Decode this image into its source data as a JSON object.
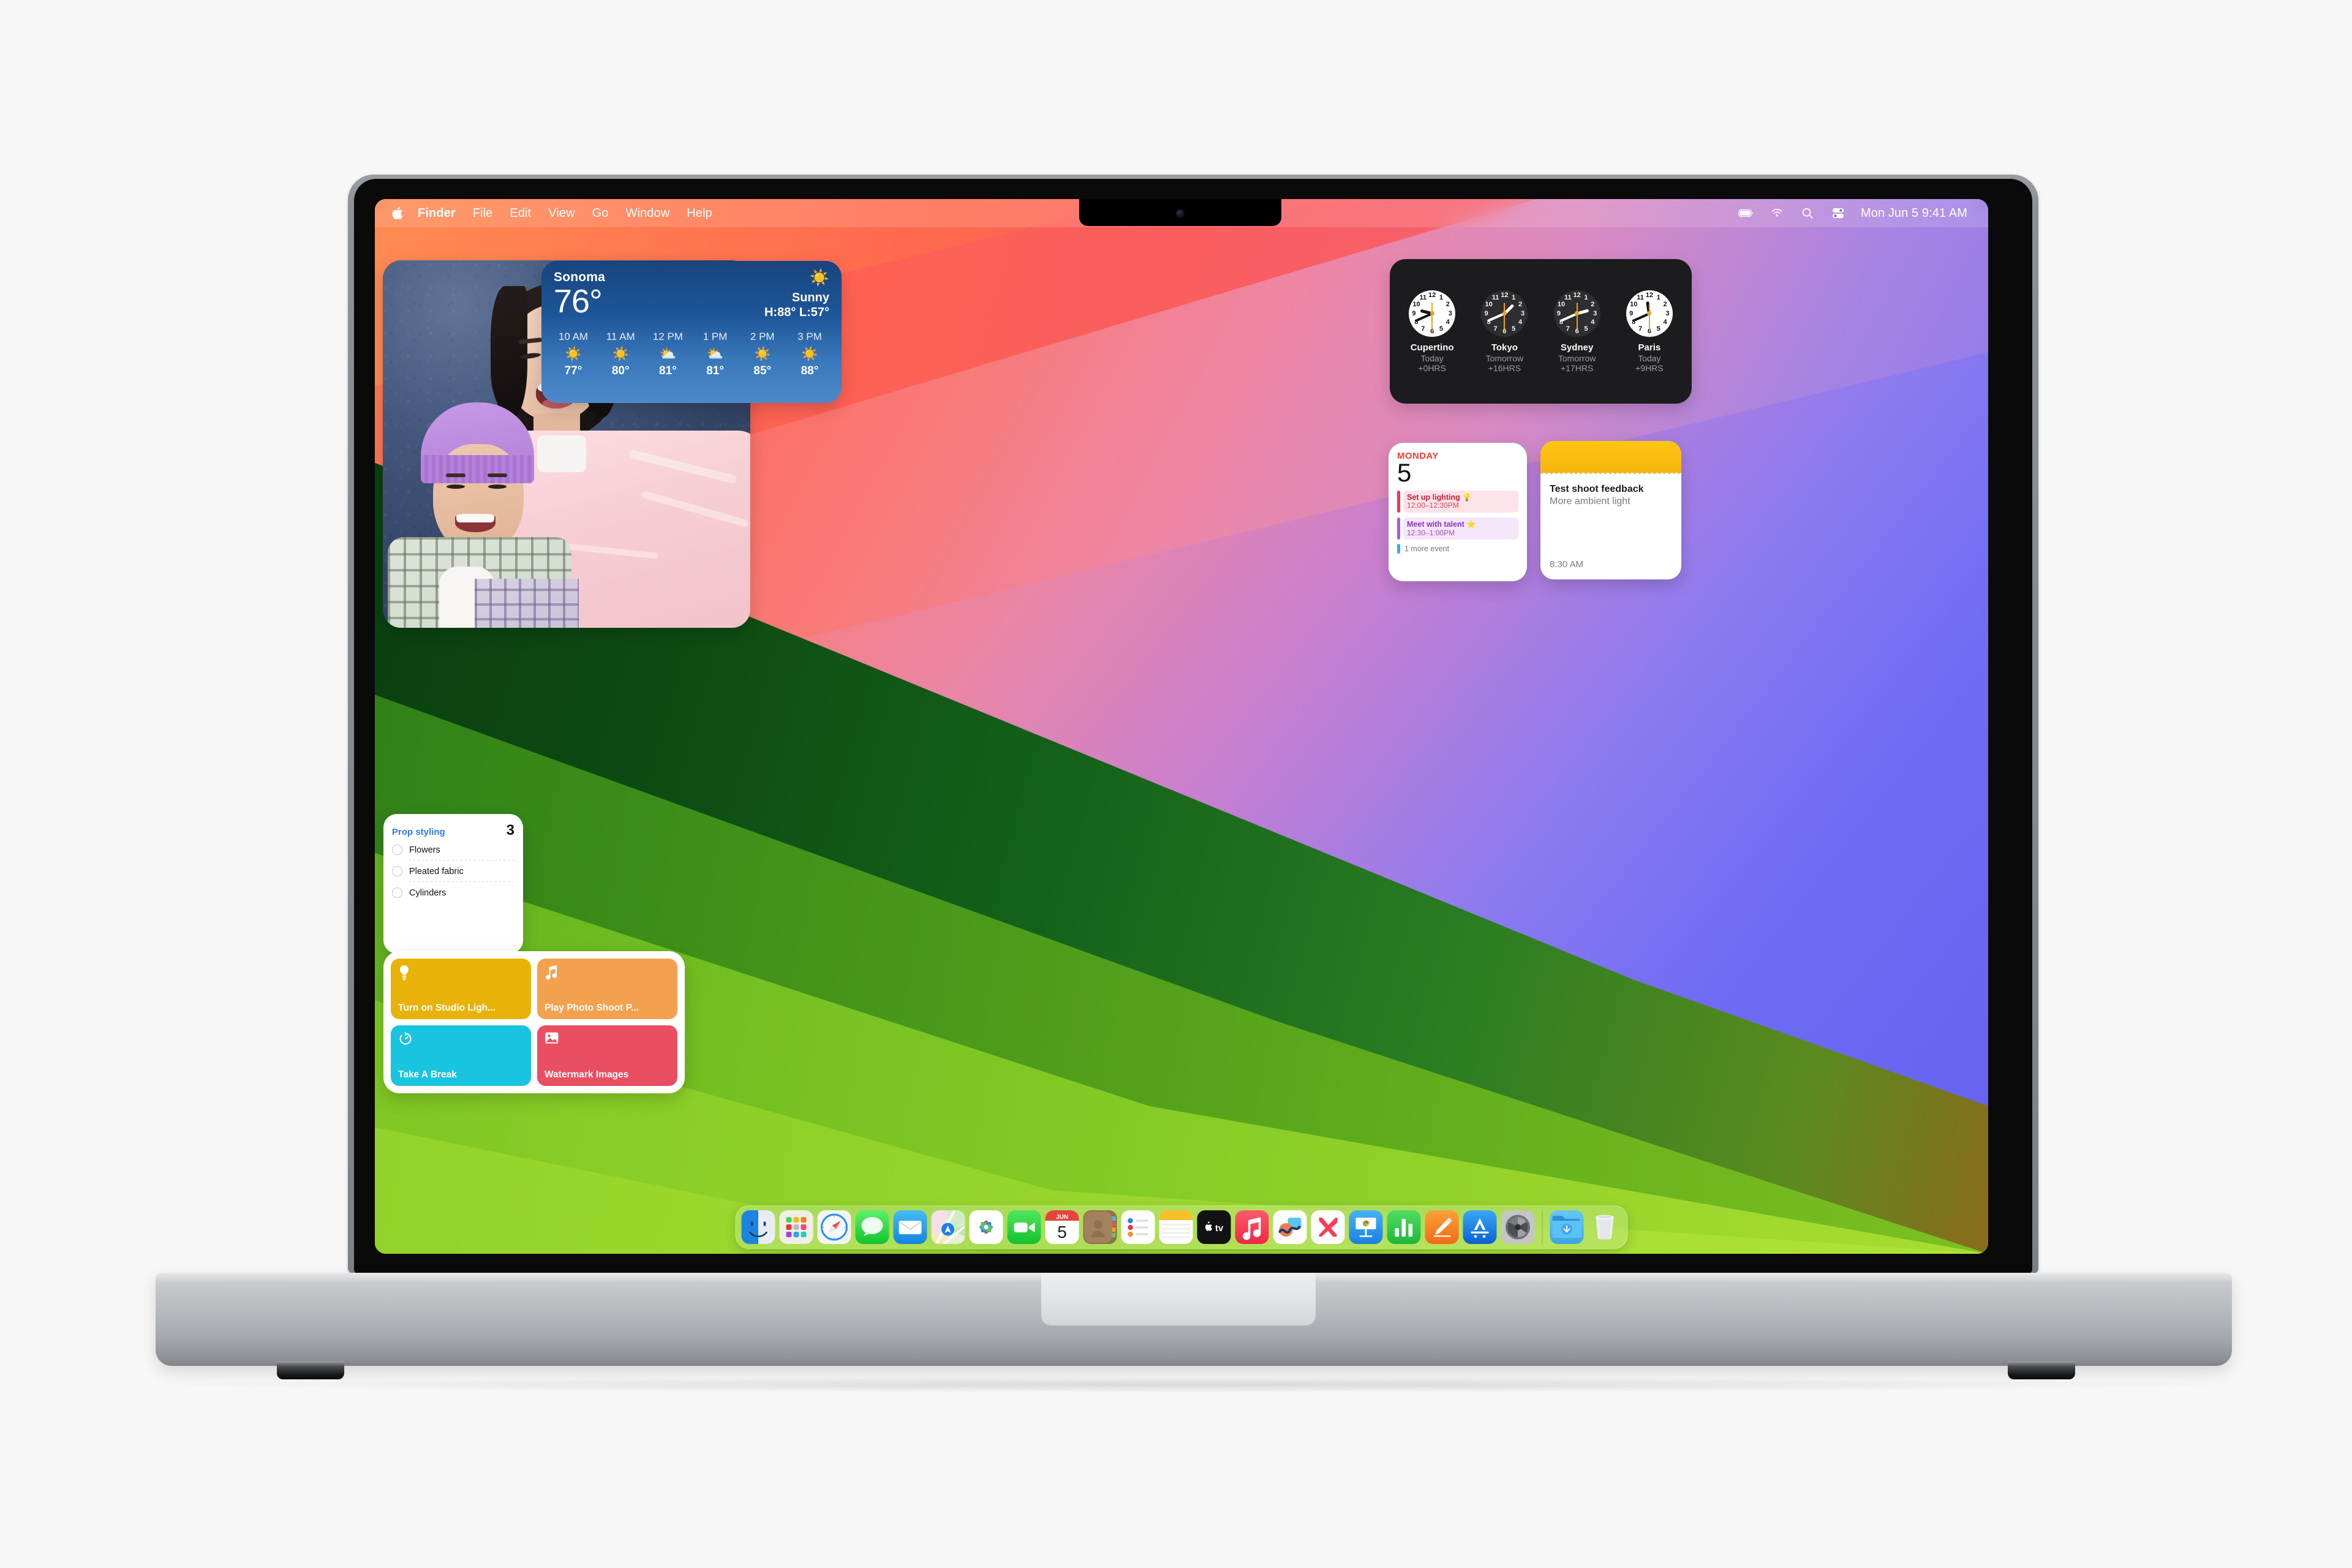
{
  "menubar": {
    "apple_icon": "apple-logo-icon",
    "items": [
      {
        "label": "Finder",
        "bold": true
      },
      {
        "label": "File",
        "bold": false
      },
      {
        "label": "Edit",
        "bold": false
      },
      {
        "label": "View",
        "bold": false
      },
      {
        "label": "Go",
        "bold": false
      },
      {
        "label": "Window",
        "bold": false
      },
      {
        "label": "Help",
        "bold": false
      }
    ],
    "status_icons": [
      "battery-icon",
      "wifi-icon",
      "search-icon",
      "control-center-icon"
    ],
    "clock": "Mon Jun 5  9:41 AM"
  },
  "weather": {
    "city": "Sonoma",
    "temperature": "76°",
    "condition_icon": "sun-icon",
    "condition": "Sunny",
    "high_low": "H:88° L:57°",
    "hours": [
      {
        "time": "10 AM",
        "icon": "sun-icon",
        "glyph": "☀️",
        "temp": "77°"
      },
      {
        "time": "11 AM",
        "icon": "sun-icon",
        "glyph": "☀️",
        "temp": "80°"
      },
      {
        "time": "12 PM",
        "icon": "sun-behind-cloud-icon",
        "glyph": "⛅",
        "temp": "81°"
      },
      {
        "time": "1 PM",
        "icon": "sun-behind-cloud-icon",
        "glyph": "⛅",
        "temp": "81°"
      },
      {
        "time": "2 PM",
        "icon": "sun-icon",
        "glyph": "☀️",
        "temp": "85°"
      },
      {
        "time": "3 PM",
        "icon": "sun-icon",
        "glyph": "☀️",
        "temp": "88°"
      }
    ]
  },
  "world_clock": {
    "clocks": [
      {
        "city": "Cupertino",
        "day": "Today",
        "offset": "+0HRS",
        "theme": "light",
        "hour_deg": 284,
        "minute_deg": 246
      },
      {
        "city": "Tokyo",
        "day": "Tomorrow",
        "offset": "+16HRS",
        "theme": "dark",
        "hour_deg": 45,
        "minute_deg": 246
      },
      {
        "city": "Sydney",
        "day": "Tomorrow",
        "offset": "+17HRS",
        "theme": "dark",
        "hour_deg": 75,
        "minute_deg": 246
      },
      {
        "city": "Paris",
        "day": "Today",
        "offset": "+9HRS",
        "theme": "light",
        "hour_deg": 352,
        "minute_deg": 246
      }
    ],
    "numerals": [
      "12",
      "1",
      "2",
      "3",
      "4",
      "5",
      "6",
      "7",
      "8",
      "9",
      "10",
      "11"
    ]
  },
  "calendar": {
    "weekday": "MONDAY",
    "date": "5",
    "events": [
      {
        "title": "Set up lighting 💡",
        "time": "12:00–12:30PM",
        "accent": "#fb2e52",
        "bg": "#fde3e8",
        "fg": "#c2203d"
      },
      {
        "title": "Meet with talent ⭐",
        "time": "12:30–1:00PM",
        "accent": "#b356e0",
        "bg": "#f5e6fa",
        "fg": "#8a36b5"
      }
    ],
    "more_label": "1 more event",
    "more_accent": "#32ade6"
  },
  "notes": {
    "title": "Test shoot feedback",
    "subtitle": "More ambient light",
    "time": "8:30 AM",
    "header_color": "#fdc612"
  },
  "reminders": {
    "list_title": "Prop styling",
    "count": "3",
    "items": [
      {
        "label": "Flowers"
      },
      {
        "label": "Pleated fabric"
      },
      {
        "label": "Cylinders"
      }
    ]
  },
  "shortcuts": {
    "tiles": [
      {
        "label": "Turn on Studio Ligh...",
        "icon": "lightbulb-icon",
        "glyph": "💡",
        "color": "#e8b209"
      },
      {
        "label": "Play Photo Shoot P...",
        "icon": "music-note-icon",
        "glyph": "♪",
        "color": "#f3a council"
      },
      {
        "label": "Take A Break",
        "icon": "timer-icon",
        "glyph": "◴",
        "color": "#18c4e0"
      },
      {
        "label": "Watermark Images",
        "icon": "photo-icon",
        "glyph": "❖",
        "color": "#ea4e63"
      }
    ]
  },
  "dock": {
    "apps": [
      {
        "name": "Finder",
        "icon": "finder-icon",
        "running": true
      },
      {
        "name": "Launchpad",
        "icon": "launchpad-icon",
        "running": false
      },
      {
        "name": "Safari",
        "icon": "safari-icon",
        "running": false
      },
      {
        "name": "Messages",
        "icon": "messages-icon",
        "running": false
      },
      {
        "name": "Mail",
        "icon": "mail-icon",
        "running": false
      },
      {
        "name": "Maps",
        "icon": "maps-icon",
        "running": false
      },
      {
        "name": "Photos",
        "icon": "photos-icon",
        "running": false
      },
      {
        "name": "FaceTime",
        "icon": "facetime-icon",
        "running": false
      },
      {
        "name": "Calendar",
        "icon": "calendar-icon",
        "running": false,
        "month": "JUN",
        "day": "5"
      },
      {
        "name": "Contacts",
        "icon": "contacts-icon",
        "running": false
      },
      {
        "name": "Reminders",
        "icon": "reminders-icon",
        "running": false
      },
      {
        "name": "Notes",
        "icon": "notes-icon",
        "running": false
      },
      {
        "name": "TV",
        "icon": "appletv-icon",
        "running": false,
        "label": "tv"
      },
      {
        "name": "Music",
        "icon": "music-icon",
        "running": false
      },
      {
        "name": "Freeform",
        "icon": "freeform-icon",
        "running": false
      },
      {
        "name": "News",
        "icon": "news-icon",
        "running": false
      },
      {
        "name": "Keynote",
        "icon": "keynote-icon",
        "running": false
      },
      {
        "name": "Numbers",
        "icon": "numbers-icon",
        "running": false
      },
      {
        "name": "Pages",
        "icon": "pages-icon",
        "running": false
      },
      {
        "name": "App Store",
        "icon": "appstore-icon",
        "running": false
      },
      {
        "name": "System Settings",
        "icon": "system-settings-icon",
        "running": false
      }
    ],
    "extras": [
      {
        "name": "Downloads",
        "icon": "downloads-folder-icon"
      },
      {
        "name": "Trash",
        "icon": "trash-icon"
      }
    ]
  },
  "photo_widget": {
    "alt": "Photo of a woman and child smiling in front of a navy blue textured wall"
  }
}
